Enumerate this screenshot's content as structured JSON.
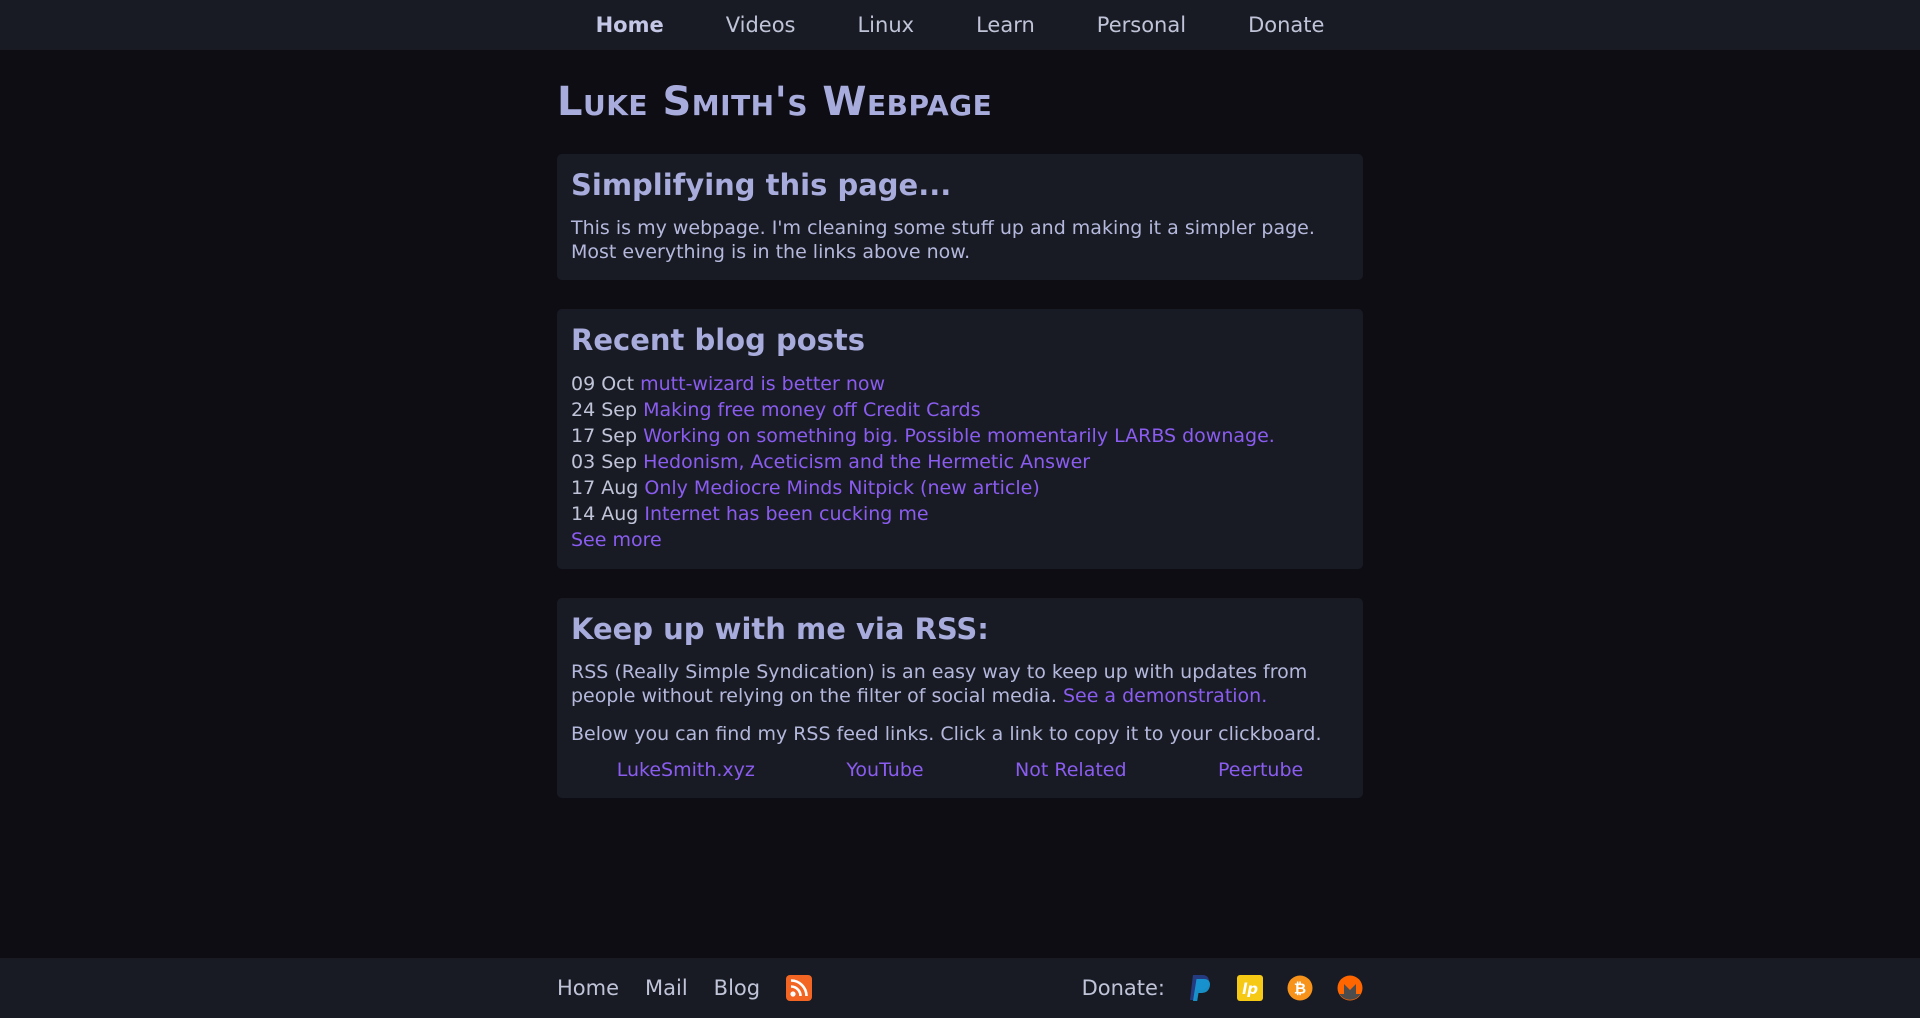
{
  "nav": {
    "items": [
      {
        "label": "Home",
        "active": true
      },
      {
        "label": "Videos"
      },
      {
        "label": "Linux"
      },
      {
        "label": "Learn"
      },
      {
        "label": "Personal"
      },
      {
        "label": "Donate"
      }
    ]
  },
  "page_title": "Luke Smith's Webpage",
  "intro": {
    "heading": "Simplifying this page...",
    "line1": "This is my webpage. I'm cleaning some stuff up and making it a simpler page.",
    "line2": "Most everything is in the links above now."
  },
  "blog": {
    "heading": "Recent blog posts",
    "posts": [
      {
        "date": "09 Oct",
        "title": "mutt-wizard is better now"
      },
      {
        "date": "24 Sep",
        "title": "Making free money off Credit Cards"
      },
      {
        "date": "17 Sep",
        "title": "Working on something big. Possible momentarily LARBS downage."
      },
      {
        "date": "03 Sep",
        "title": "Hedonism, Aceticism and the Hermetic Answer"
      },
      {
        "date": "17 Aug",
        "title": "Only Mediocre Minds Nitpick (new article)"
      },
      {
        "date": "14 Aug",
        "title": "Internet has been cucking me"
      }
    ],
    "see_more": "See more"
  },
  "rss": {
    "heading": "Keep up with me via RSS:",
    "description": "RSS (Really Simple Syndication) is an easy way to keep up with updates from people without relying on the filter of social media.",
    "demo_link": "See a demonstration.",
    "instructions": "Below you can find my RSS feed links. Click a link to copy it to your clickboard.",
    "feeds": [
      "LukeSmith.xyz",
      "YouTube",
      "Not Related",
      "Peertube"
    ]
  },
  "footer": {
    "links": [
      "Home",
      "Mail",
      "Blog"
    ],
    "rss_icon": "rss-icon",
    "donate_label": "Donate:",
    "donate_icons": [
      "paypal-icon",
      "liberapay-icon",
      "bitcoin-icon",
      "monero-icon"
    ]
  },
  "colors": {
    "background": "#0e0d14",
    "panel": "#191b24",
    "link": "#8a5cf0",
    "heading": "#a8acdc"
  }
}
